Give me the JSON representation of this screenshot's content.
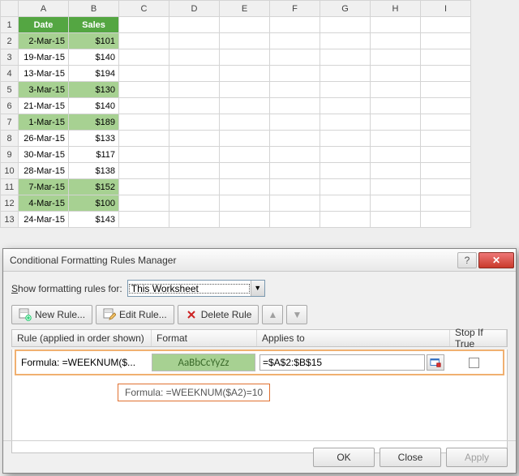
{
  "sheet": {
    "columns": [
      "A",
      "B",
      "C",
      "D",
      "E",
      "F",
      "G",
      "H",
      "I"
    ],
    "header_row": [
      "Date",
      "Sales"
    ],
    "rows": [
      {
        "n": 1,
        "cells": [
          "Date",
          "Sales"
        ],
        "header": true
      },
      {
        "n": 2,
        "cells": [
          "2-Mar-15",
          "$101"
        ],
        "hl": true
      },
      {
        "n": 3,
        "cells": [
          "19-Mar-15",
          "$140"
        ],
        "hl": false
      },
      {
        "n": 4,
        "cells": [
          "13-Mar-15",
          "$194"
        ],
        "hl": false
      },
      {
        "n": 5,
        "cells": [
          "3-Mar-15",
          "$130"
        ],
        "hl": true
      },
      {
        "n": 6,
        "cells": [
          "21-Mar-15",
          "$140"
        ],
        "hl": false
      },
      {
        "n": 7,
        "cells": [
          "1-Mar-15",
          "$189"
        ],
        "hl": true
      },
      {
        "n": 8,
        "cells": [
          "26-Mar-15",
          "$133"
        ],
        "hl": false
      },
      {
        "n": 9,
        "cells": [
          "30-Mar-15",
          "$117"
        ],
        "hl": false
      },
      {
        "n": 10,
        "cells": [
          "28-Mar-15",
          "$138"
        ],
        "hl": false
      },
      {
        "n": 11,
        "cells": [
          "7-Mar-15",
          "$152"
        ],
        "hl": true
      },
      {
        "n": 12,
        "cells": [
          "4-Mar-15",
          "$100"
        ],
        "hl": true
      },
      {
        "n": 13,
        "cells": [
          "24-Mar-15",
          "$143"
        ],
        "hl": false
      }
    ]
  },
  "dialog": {
    "title": "Conditional Formatting Rules Manager",
    "show_label_pre": "S",
    "show_label": "how formatting rules for:",
    "scope_value": "This Worksheet",
    "buttons": {
      "new": "New Rule...",
      "edit": "Edit Rule...",
      "delete": "Delete Rule"
    },
    "list_headers": {
      "rule": "Rule (applied in order shown)",
      "format": "Format",
      "applies": "Applies to",
      "stop": "Stop If True"
    },
    "rule": {
      "text": "Formula: =WEEKNUM($...",
      "preview": "AaBbCcYyZz",
      "applies_to": "=$A$2:$B$15"
    },
    "tooltip": "Formula: =WEEKNUM($A2)=10",
    "footer": {
      "ok": "OK",
      "close": "Close",
      "apply": "Apply"
    }
  }
}
